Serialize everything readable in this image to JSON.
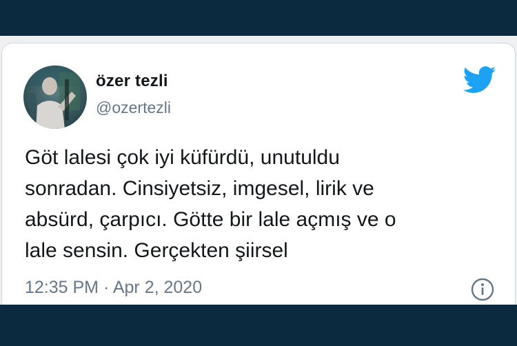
{
  "tweet": {
    "author_name": "özer tezli",
    "author_handle": "@ozertezli",
    "text_lines": [
      "Göt lalesi çok iyi küfürdü, unutuldu",
      "sonradan. Cinsiyetsiz, imgesel, lirik ve",
      "absürd, çarpıcı. Götte bir lale açmış ve o",
      "lale sensin. Gerçekten şiirsel"
    ],
    "timestamp": "12:35 PM · Apr 2, 2020"
  },
  "icons": {
    "brand": "twitter-bird-icon",
    "info": "info-icon",
    "avatar": "avatar"
  },
  "colors": {
    "background": "#0b2a3f",
    "twitter_blue": "#1da1f2",
    "text": "#14171a",
    "secondary_text": "#657786"
  }
}
